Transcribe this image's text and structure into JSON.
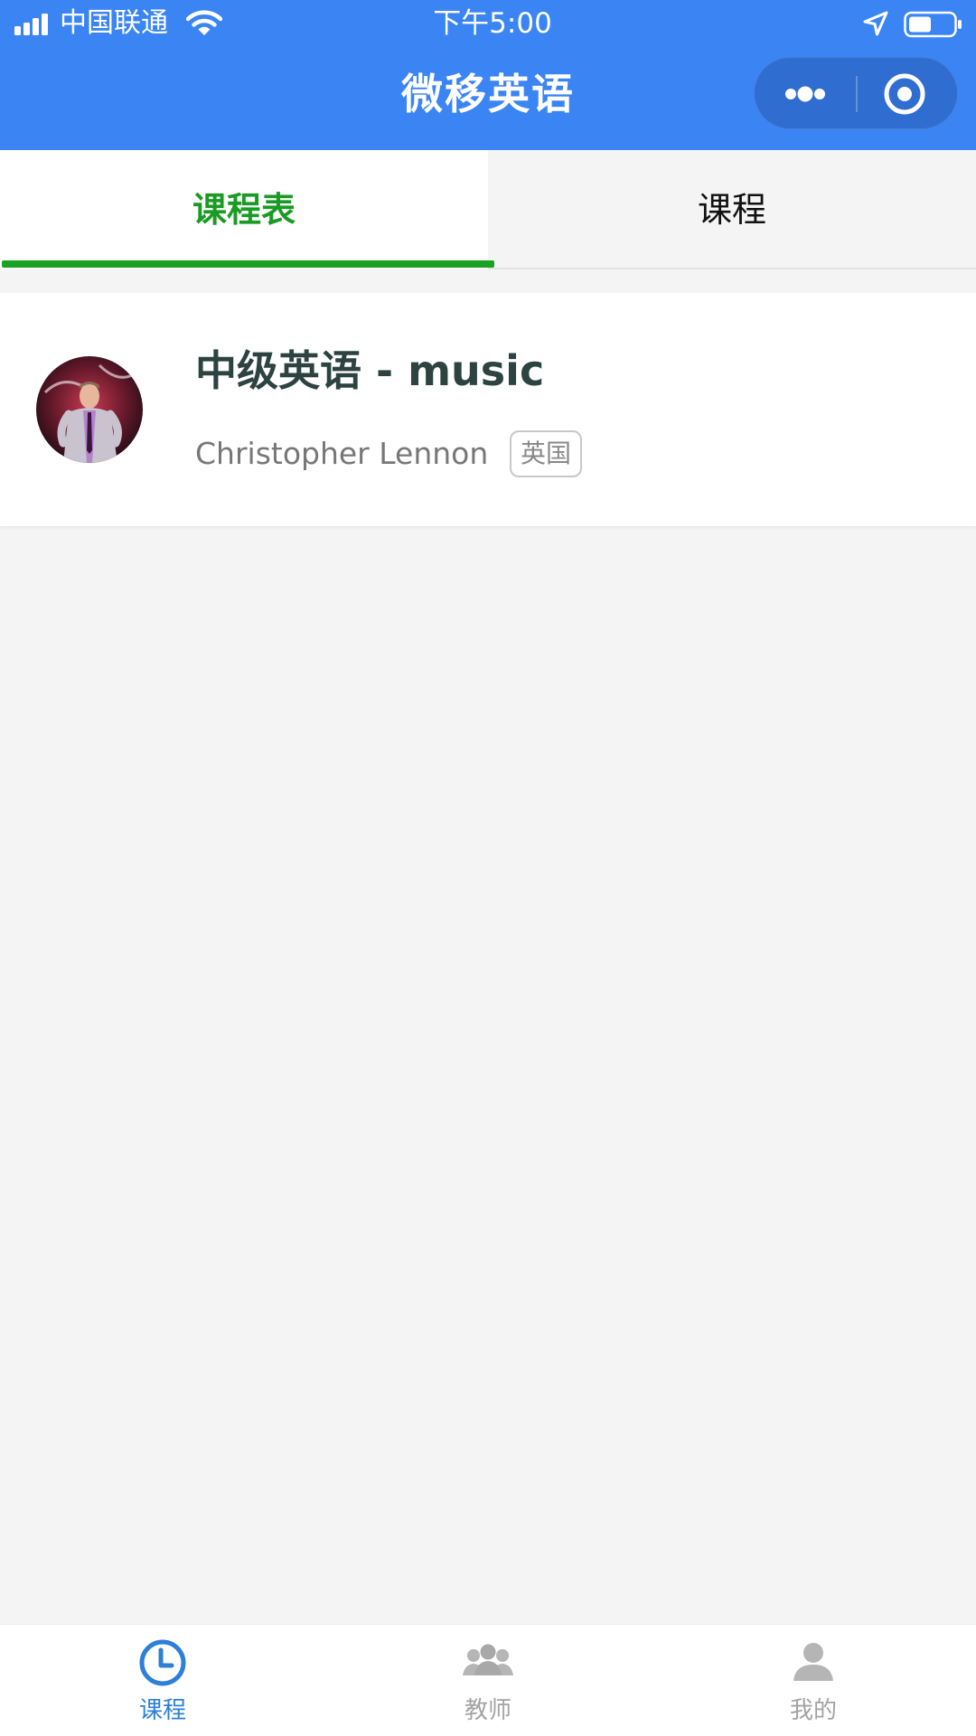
{
  "status_bar": {
    "carrier": "中国联通",
    "time": "下午5:00",
    "icons": [
      "signal-icon",
      "wifi-icon",
      "location-icon",
      "battery-icon"
    ]
  },
  "nav": {
    "title": "微移英语",
    "capsule_icons": [
      "more-icon",
      "close-miniprogram-icon"
    ]
  },
  "tabs": [
    {
      "label": "课程表",
      "active": true
    },
    {
      "label": "课程",
      "active": false
    }
  ],
  "courses": [
    {
      "title": "中级英语 - music",
      "teacher": "Christopher Lennon",
      "country": "英国",
      "avatar_icon": "teacher-avatar"
    }
  ],
  "tabbar": {
    "items": [
      {
        "label": "课程",
        "icon": "clock-icon",
        "active": true
      },
      {
        "label": "教师",
        "icon": "teachers-icon",
        "active": false
      },
      {
        "label": "我的",
        "icon": "profile-icon",
        "active": false
      }
    ]
  },
  "colors": {
    "header_bg": "#3a84f4",
    "tab_active_text": "#1a9b24",
    "tab_indicator": "#1aa224",
    "tabbar_active": "#2d7fd8",
    "tabbar_inactive": "#a3a3a3",
    "page_bg": "#f4f4f4"
  }
}
